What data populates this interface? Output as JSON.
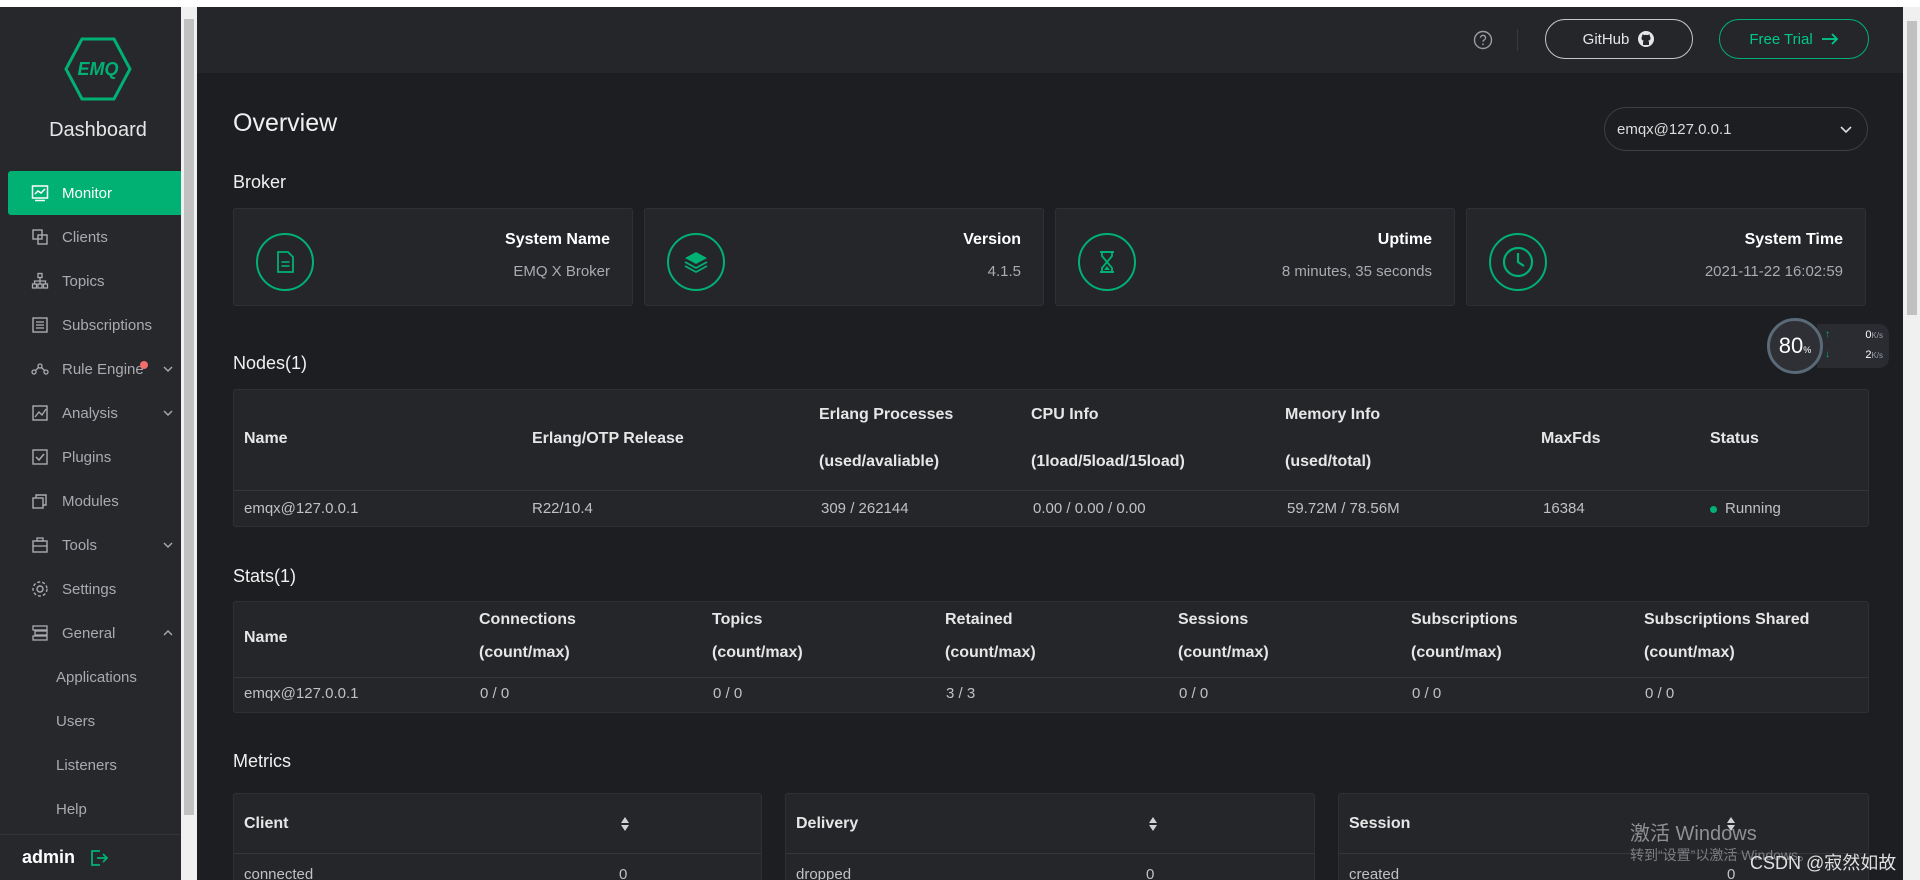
{
  "sidebar": {
    "logo_text": "EMQ",
    "title": "Dashboard",
    "items": [
      {
        "label": "Monitor"
      },
      {
        "label": "Clients"
      },
      {
        "label": "Topics"
      },
      {
        "label": "Subscriptions"
      },
      {
        "label": "Rule Engine"
      },
      {
        "label": "Analysis"
      },
      {
        "label": "Plugins"
      },
      {
        "label": "Modules"
      },
      {
        "label": "Tools"
      },
      {
        "label": "Settings"
      },
      {
        "label": "General"
      }
    ],
    "sub_items": [
      {
        "label": "Applications"
      },
      {
        "label": "Users"
      },
      {
        "label": "Listeners"
      },
      {
        "label": "Help"
      }
    ],
    "user": "admin"
  },
  "header": {
    "github_label": "GitHub",
    "trial_label": "Free Trial"
  },
  "page": {
    "title": "Overview",
    "node_select": "emqx@127.0.0.1"
  },
  "broker": {
    "title": "Broker",
    "cards": [
      {
        "label": "System Name",
        "value": "EMQ X Broker",
        "icon": "document-icon"
      },
      {
        "label": "Version",
        "value": "4.1.5",
        "icon": "layers-icon"
      },
      {
        "label": "Uptime",
        "value": "8 minutes, 35 seconds",
        "icon": "hourglass-icon"
      },
      {
        "label": "System Time",
        "value": "2021-11-22 16:02:59",
        "icon": "clock-icon"
      }
    ]
  },
  "gauge": {
    "percent": "80",
    "percent_unit": "%",
    "up_value": "0",
    "down_value": "2",
    "unit": "K/s"
  },
  "nodes": {
    "title": "Nodes(1)",
    "headers": [
      {
        "line1": "Name",
        "line2": ""
      },
      {
        "line1": "Erlang/OTP Release",
        "line2": ""
      },
      {
        "line1": "Erlang Processes",
        "line2": "(used/avaliable)"
      },
      {
        "line1": "CPU Info",
        "line2": "(1load/5load/15load)"
      },
      {
        "line1": "Memory Info",
        "line2": "(used/total)"
      },
      {
        "line1": "MaxFds",
        "line2": ""
      },
      {
        "line1": "Status",
        "line2": ""
      }
    ],
    "row": [
      "emqx@127.0.0.1",
      "R22/10.4",
      "309 / 262144",
      "0.00 / 0.00 / 0.00",
      "59.72M / 78.56M",
      "16384",
      "Running"
    ]
  },
  "stats": {
    "title": "Stats(1)",
    "headers": [
      {
        "line1": "Name",
        "line2": ""
      },
      {
        "line1": "Connections",
        "line2": "(count/max)"
      },
      {
        "line1": "Topics",
        "line2": "(count/max)"
      },
      {
        "line1": "Retained",
        "line2": "(count/max)"
      },
      {
        "line1": "Sessions",
        "line2": "(count/max)"
      },
      {
        "line1": "Subscriptions",
        "line2": "(count/max)"
      },
      {
        "line1": "Subscriptions Shared",
        "line2": "(count/max)"
      }
    ],
    "row": [
      "emqx@127.0.0.1",
      "0 / 0",
      "0 / 0",
      "3 / 3",
      "0 / 0",
      "0 / 0",
      "0 / 0"
    ]
  },
  "metrics": {
    "title": "Metrics",
    "cards": [
      {
        "header": "Client",
        "row_label": "connected",
        "row_value": "0"
      },
      {
        "header": "Delivery",
        "row_label": "dropped",
        "row_value": "0"
      },
      {
        "header": "Session",
        "row_label": "created",
        "row_value": "0"
      }
    ]
  },
  "watermark": {
    "line1": "激活 Windows",
    "line2": "转到“设置”以激活 Windows。",
    "csdn": "CSDN @寂然如故"
  }
}
